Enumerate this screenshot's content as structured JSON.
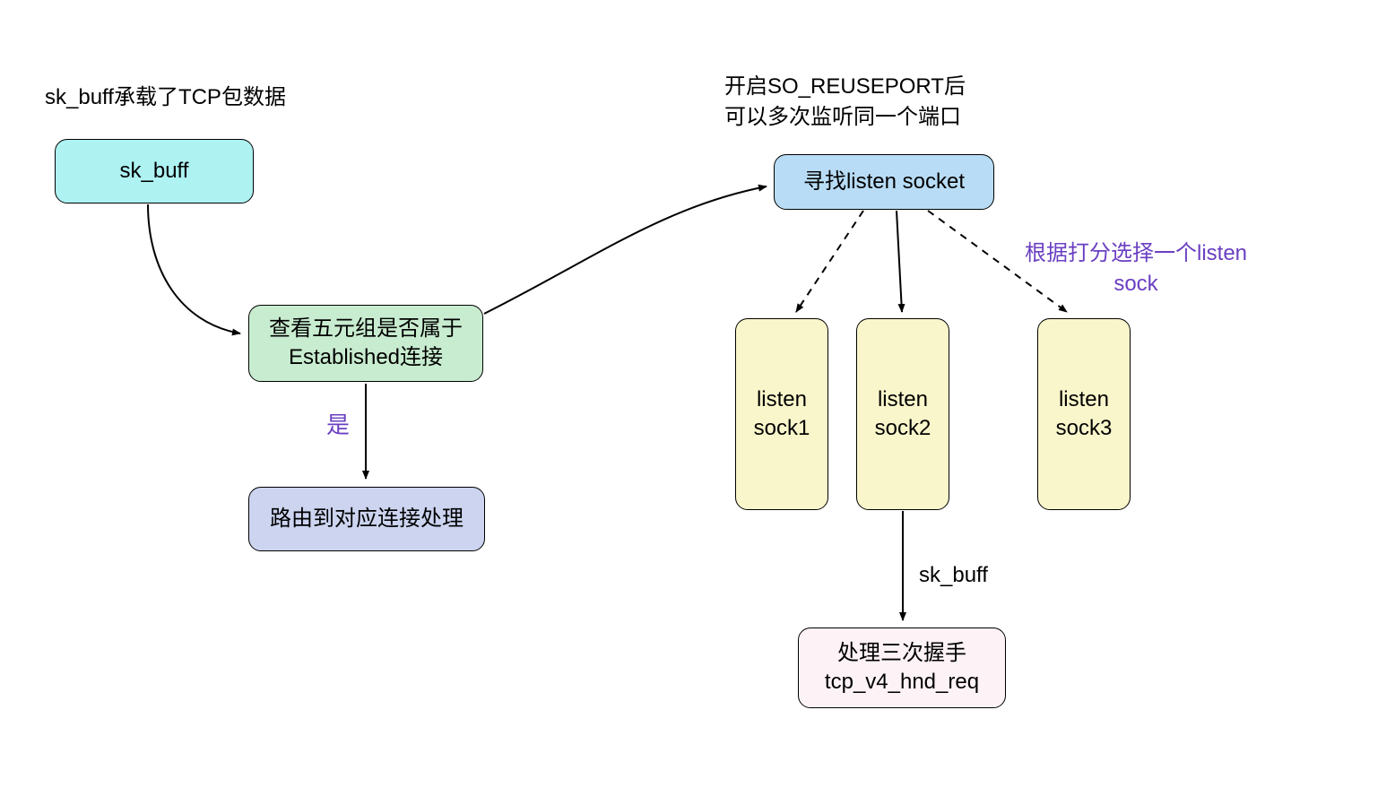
{
  "annotations": {
    "top_left": "sk_buff承载了TCP包数据",
    "top_right_l1": "开启SO_REUSEPORT后",
    "top_right_l2": "可以多次监听同一个端口",
    "yes": "是",
    "score_l1": "根据打分选择一个listen",
    "score_l2": "sock",
    "skbuff_label": "sk_buff"
  },
  "nodes": {
    "skbuff": "sk_buff",
    "check_l1": "查看五元组是否属于",
    "check_l2": "Established连接",
    "route": "路由到对应连接处理",
    "find": "寻找listen socket",
    "sock1_l1": "listen",
    "sock1_l2": "sock1",
    "sock2_l1": "listen",
    "sock2_l2": "sock2",
    "sock3_l1": "listen",
    "sock3_l2": "sock3",
    "hnd_l1": "处理三次握手",
    "hnd_l2": "tcp_v4_hnd_req"
  }
}
